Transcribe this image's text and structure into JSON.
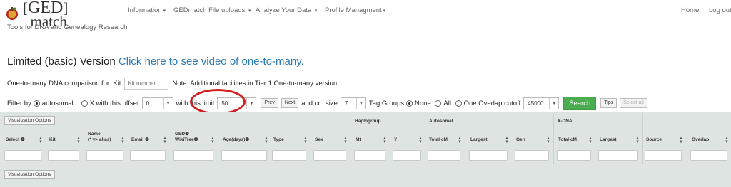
{
  "header": {
    "logo_ged": "GED",
    "logo_match": "match",
    "tagline": "Tools for DNA and Genealogy Research",
    "nav": [
      {
        "label": "Information",
        "caret": "▾"
      },
      {
        "label": "GEDmatch File uploads",
        "caret": "▾"
      },
      {
        "label": "Analyze Your Data",
        "caret": "▾"
      },
      {
        "label": "Profile Managment",
        "caret": "▾"
      }
    ],
    "home": "Home",
    "logout": "Log out"
  },
  "title": {
    "prefix": "Limited (basic) Version",
    "link": "Click here to see video of one-to-many."
  },
  "kit": {
    "label": "One-to-many DNA comparison for: Kit",
    "placeholder": "Kit number",
    "note": "Note: Additional facilities in Tier 1 One-to-many version."
  },
  "filter": {
    "filter_by": "Filter by",
    "autosomal": "autosomal",
    "x_offset": "X with this offset",
    "offset_value": "0",
    "with_limit": "with this limit",
    "limit_value": "50",
    "prev": "Prev",
    "next": "Next",
    "cm_size": "and cm size",
    "cm_value": "7",
    "tag_groups": "Tag Groups",
    "none": "None",
    "all": "All",
    "one": "One",
    "overlap_cutoff": "Overlap cutoff",
    "overlap_value": "45000",
    "search": "Search",
    "tips": "Tips",
    "select_all": "Select all"
  },
  "grid": {
    "vis_options": "Visualization Options",
    "groups": {
      "haplogroup": "Haplogroup",
      "autosomal": "Autosomal",
      "xdna": "X-DNA"
    },
    "columns": [
      {
        "label": "Select ❶"
      },
      {
        "label": "Kit"
      },
      {
        "label": "Name\n(* => alias)"
      },
      {
        "label": "Email ❷"
      },
      {
        "label": "GED❸\nWikiTree❸"
      },
      {
        "label": "Age(days)❸"
      },
      {
        "label": "Type"
      },
      {
        "label": "Sex"
      },
      {
        "label": "Mt"
      },
      {
        "label": "Y"
      },
      {
        "label": "Total cM"
      },
      {
        "label": "Largest"
      },
      {
        "label": "Gen"
      },
      {
        "label": "Total cM"
      },
      {
        "label": "Largest"
      },
      {
        "label": "Source"
      },
      {
        "label": "Overlap"
      }
    ]
  },
  "colors": {
    "link": "#2a7ab6",
    "search_green": "#4bad50",
    "highlight_red": "#d21f1f",
    "panel": "#dde4e2"
  }
}
